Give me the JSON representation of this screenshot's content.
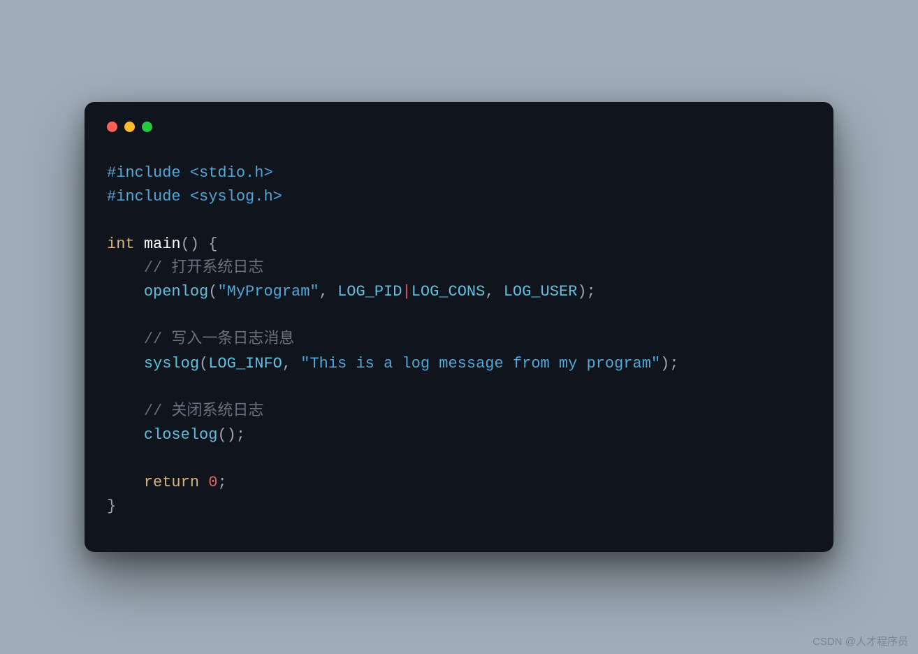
{
  "code": {
    "line1": {
      "directive": "#include",
      "header": "<stdio.h>"
    },
    "line2": {
      "directive": "#include",
      "header": "<syslog.h>"
    },
    "line4": {
      "type": "int",
      "func": "main",
      "parens": "()",
      "brace": " {"
    },
    "line5": {
      "indent": "    ",
      "comment": "// 打开系统日志"
    },
    "line6": {
      "indent": "    ",
      "func": "openlog",
      "open": "(",
      "str": "\"MyProgram\"",
      "comma1": ", ",
      "const1": "LOG_PID",
      "pipe": "|",
      "const2": "LOG_CONS",
      "comma2": ", ",
      "const3": "LOG_USER",
      "close": ");"
    },
    "line8": {
      "indent": "    ",
      "comment": "// 写入一条日志消息"
    },
    "line9": {
      "indent": "    ",
      "func": "syslog",
      "open": "(",
      "const": "LOG_INFO",
      "comma": ", ",
      "str": "\"This is a log message from my program\"",
      "close": ");"
    },
    "line11": {
      "indent": "    ",
      "comment": "// 关闭系统日志"
    },
    "line12": {
      "indent": "    ",
      "func": "closelog",
      "close": "();"
    },
    "line14": {
      "indent": "    ",
      "keyword": "return",
      "space": " ",
      "num": "0",
      "semi": ";"
    },
    "line15": {
      "brace": "}"
    }
  },
  "watermark": "CSDN @人才程序员"
}
